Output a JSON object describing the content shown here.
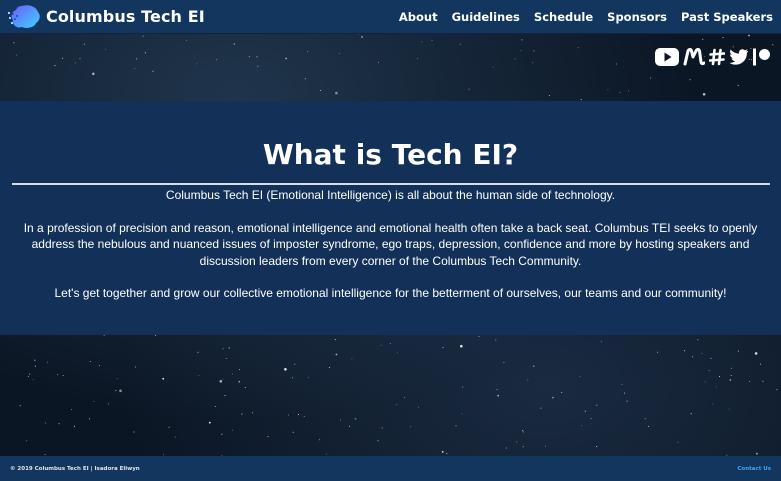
{
  "brand": {
    "name": "Columbus Tech EI"
  },
  "nav": {
    "items": [
      {
        "label": "About"
      },
      {
        "label": "Guidelines"
      },
      {
        "label": "Schedule"
      },
      {
        "label": "Sponsors"
      },
      {
        "label": "Past Speakers"
      }
    ]
  },
  "social": {
    "icons": [
      "youtube-icon",
      "meetup-icon",
      "slack-icon",
      "twitter-icon",
      "patreon-icon"
    ]
  },
  "about": {
    "title": "What is Tech EI?",
    "paragraphs": [
      "Columbus Tech EI (Emotional Intelligence) is all about the human side of technology.",
      "In a profession of precision and reason, emotional intelligence and emotional health often take a back seat. Columbus TEI seeks to openly address the nebulous and nuanced issues of imposter syndrome, ego traps, depression, confidence and more by hosting speakers and discussion leaders from every corner of the Columbus Tech Community.",
      "Let's get together and grow our collective emotional intelligence for the betterment of ourselves, our teams and our community!"
    ]
  },
  "footer": {
    "copyright": "© 2019 Columbus Tech EI | Isadora Eliwyn",
    "contact": "Contact Us"
  },
  "colors": {
    "navbar": "#13365e",
    "panel": "#133158",
    "link": "#3aa6ff"
  }
}
